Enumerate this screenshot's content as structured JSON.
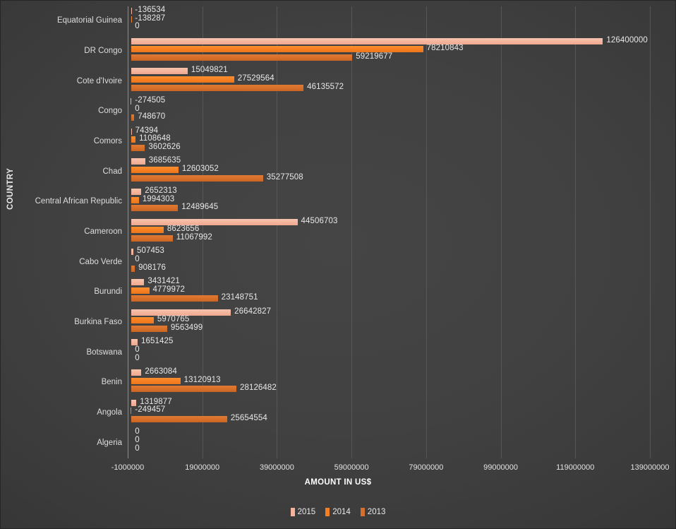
{
  "chart_data": {
    "type": "bar",
    "orientation": "horizontal",
    "title": "",
    "xlabel": "AMOUNT IN US$",
    "ylabel": "COUNTRY",
    "xlim": [
      -1000000,
      139000000
    ],
    "xticks": [
      -1000000,
      19000000,
      39000000,
      59000000,
      79000000,
      99000000,
      119000000,
      139000000
    ],
    "xtick_labels": [
      "-1000000",
      "19000000",
      "39000000",
      "59000000",
      "79000000",
      "99000000",
      "119000000",
      "139000000"
    ],
    "grid": true,
    "legend_position": "bottom",
    "series": [
      {
        "name": "2015",
        "color": "#f4b49c",
        "values": [
          -136534,
          126400000,
          15049821,
          -274505,
          74394,
          3685635,
          2652313,
          44506703,
          507453,
          3431421,
          26642827,
          1651425,
          2663084,
          1319877,
          0
        ]
      },
      {
        "name": "2014",
        "color": "#f57f21",
        "values": [
          -138287,
          78210843,
          27529564,
          0,
          1108648,
          12603052,
          1994303,
          8623656,
          0,
          4779972,
          5970765,
          0,
          13120913,
          -249457,
          0
        ]
      },
      {
        "name": "2013",
        "color": "#d66f29",
        "values": [
          0,
          59219677,
          46135572,
          748670,
          3602626,
          35277508,
          12489645,
          11067992,
          908176,
          23148751,
          9563499,
          0,
          28126482,
          25654554,
          0
        ]
      }
    ],
    "categories": [
      "Equatorial Guinea",
      "DR Congo",
      "Cote d'Ivoire",
      "Congo",
      "Comors",
      "Chad",
      "Central African Republic",
      "Cameroon",
      "Cabo Verde",
      "Burundi",
      "Burkina Faso",
      "Botswana",
      "Benin",
      "Angola",
      "Algeria"
    ],
    "data_labels": [
      {
        "category": "Equatorial Guinea",
        "2015": "-136534",
        "2014": "-138287",
        "2013": "0"
      },
      {
        "category": "DR Congo",
        "2015": "126400000",
        "2014": "78210843",
        "2013": "59219677"
      },
      {
        "category": "Cote d'Ivoire",
        "2015": "15049821",
        "2014": "27529564",
        "2013": "46135572"
      },
      {
        "category": "Congo",
        "2015": "-274505",
        "2014": "0",
        "2013": "748670"
      },
      {
        "category": "Comors",
        "2015": "74394",
        "2014": "1108648",
        "2013": "3602626"
      },
      {
        "category": "Chad",
        "2015": "3685635",
        "2014": "12603052",
        "2013": "35277508"
      },
      {
        "category": "Central African Republic",
        "2015": "2652313",
        "2014": "1994303",
        "2013": "12489645"
      },
      {
        "category": "Cameroon",
        "2015": "44506703",
        "2014": "8623656",
        "2013": "11067992"
      },
      {
        "category": "Cabo Verde",
        "2015": "507453",
        "2014": "0",
        "2013": "908176"
      },
      {
        "category": "Burundi",
        "2015": "3431421",
        "2014": "4779972",
        "2013": "23148751"
      },
      {
        "category": "Burkina Faso",
        "2015": "26642827",
        "2014": "5970765",
        "2013": "9563499"
      },
      {
        "category": "Botswana",
        "2015": "1651425",
        "2014": "0",
        "2013": "0"
      },
      {
        "category": "Benin",
        "2015": "2663084",
        "2014": "13120913",
        "2013": "28126482"
      },
      {
        "category": "Angola",
        "2015": "1319877",
        "2014": "-249457",
        "2013": "25654554"
      },
      {
        "category": "Algeria",
        "2015": "0",
        "2014": "0",
        "2013": "0"
      }
    ]
  },
  "legend": {
    "items": [
      {
        "label": "2015",
        "color": "#f4b49c"
      },
      {
        "label": "2014",
        "color": "#f57f21"
      },
      {
        "label": "2013",
        "color": "#d66f29"
      }
    ]
  },
  "theme": {
    "background": "#3d3d3d",
    "gridline": "#5a5a5a",
    "axis_line": "#8c8c8c",
    "text": "#e8e8e8"
  }
}
